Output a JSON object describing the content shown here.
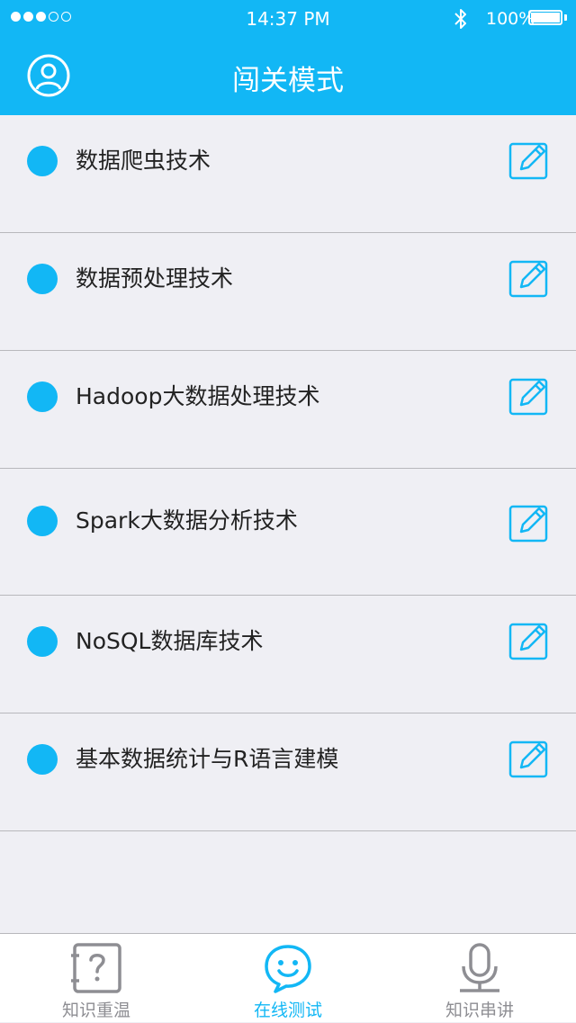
{
  "status": {
    "time": "14:37 PM",
    "battery": "100%"
  },
  "header": {
    "title": "闯关模式"
  },
  "items": [
    {
      "label": "数据爬虫技术"
    },
    {
      "label": "数据预处理技术"
    },
    {
      "label": "Hadoop大数据处理技术"
    },
    {
      "label": "Spark大数据分析技术"
    },
    {
      "label": "NoSQL数据库技术"
    },
    {
      "label": "基本数据统计与R语言建模"
    }
  ],
  "tabs": [
    {
      "label": "知识重温",
      "icon": "question-book-icon",
      "active": false
    },
    {
      "label": "在线测试",
      "icon": "smiley-chat-icon",
      "active": true
    },
    {
      "label": "知识串讲",
      "icon": "microphone-icon",
      "active": false
    }
  ],
  "colors": {
    "accent": "#12b7f5",
    "background": "#efeff4",
    "inactive": "#8e8e93"
  }
}
